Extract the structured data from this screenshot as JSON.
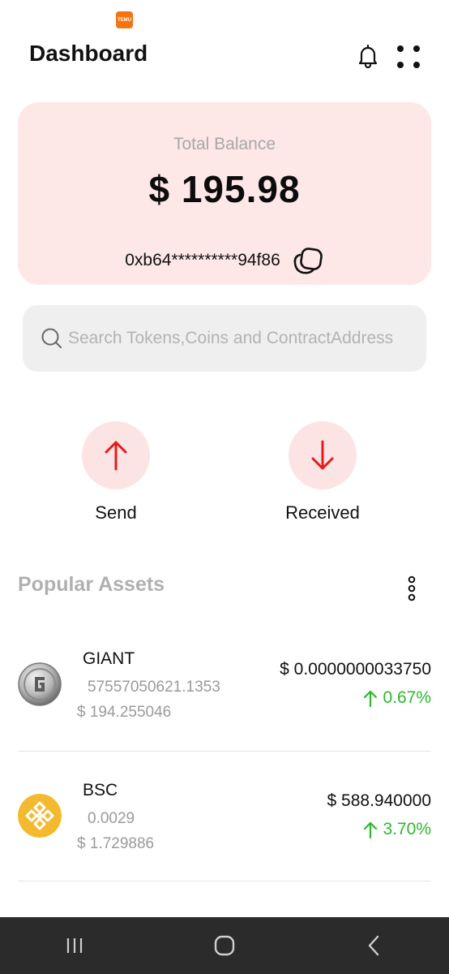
{
  "status_bar": {
    "notification_badge": "TEMU"
  },
  "header": {
    "title": "Dashboard",
    "icons": [
      "bell-icon",
      "grid-icon"
    ]
  },
  "balance_card": {
    "label": "Total Balance",
    "value": "$ 195.98",
    "wallet_address": "0xb64**********94f86"
  },
  "search": {
    "placeholder": "Search Tokens,Coins and ContractAddress"
  },
  "actions": [
    {
      "label": "Send",
      "icon": "arrow-up-icon"
    },
    {
      "label": "Received",
      "icon": "arrow-down-icon"
    }
  ],
  "popular_assets": {
    "title": "Popular Assets",
    "items": [
      {
        "name": "GIANT",
        "amount": "57557050621.1353",
        "value": "$ 194.255046",
        "price": "$ 0.0000000033750",
        "change": "0.67%",
        "icon": "giant-coin-icon"
      },
      {
        "name": "BSC",
        "amount": "0.0029",
        "value": "$ 1.729886",
        "price": "$ 588.940000",
        "change": "3.70%",
        "icon": "bnb-coin-icon"
      }
    ]
  },
  "colors": {
    "card_bg": "#fde7e7",
    "accent_red": "#e31b1b",
    "positive_green": "#2db82d",
    "muted_text": "#a8a8a8"
  }
}
